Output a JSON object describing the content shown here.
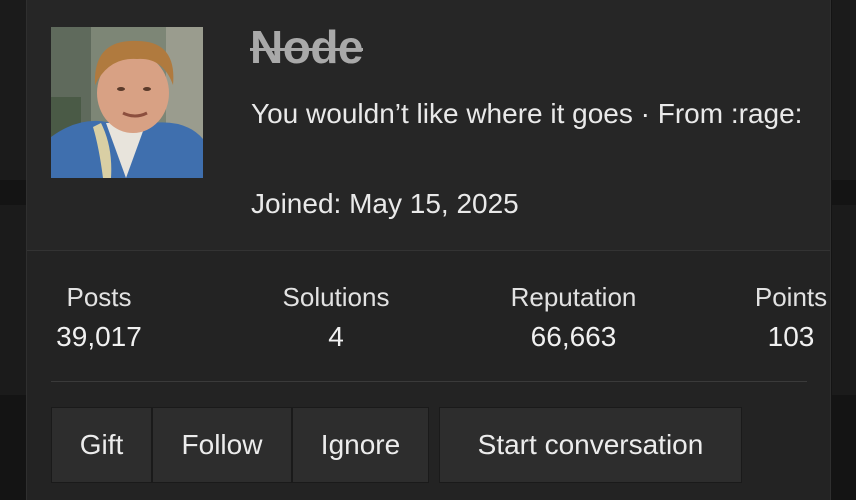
{
  "profile": {
    "username": "Node",
    "tagline": "You wouldn’t like where it goes · From :rage:",
    "joined_label": "Joined: May 15, 2025",
    "avatar_desc": "avatar"
  },
  "stats": [
    {
      "label": "Posts",
      "value": "39,017"
    },
    {
      "label": "Solutions",
      "value": "4"
    },
    {
      "label": "Reputation",
      "value": "66,663"
    },
    {
      "label": "Points",
      "value": "103"
    }
  ],
  "actions": {
    "gift": "Gift",
    "follow": "Follow",
    "ignore": "Ignore",
    "start_conversation": "Start conversation"
  },
  "colors": {
    "background": "#141414",
    "card": "#232323",
    "username_struck": "#a9a9a9"
  }
}
